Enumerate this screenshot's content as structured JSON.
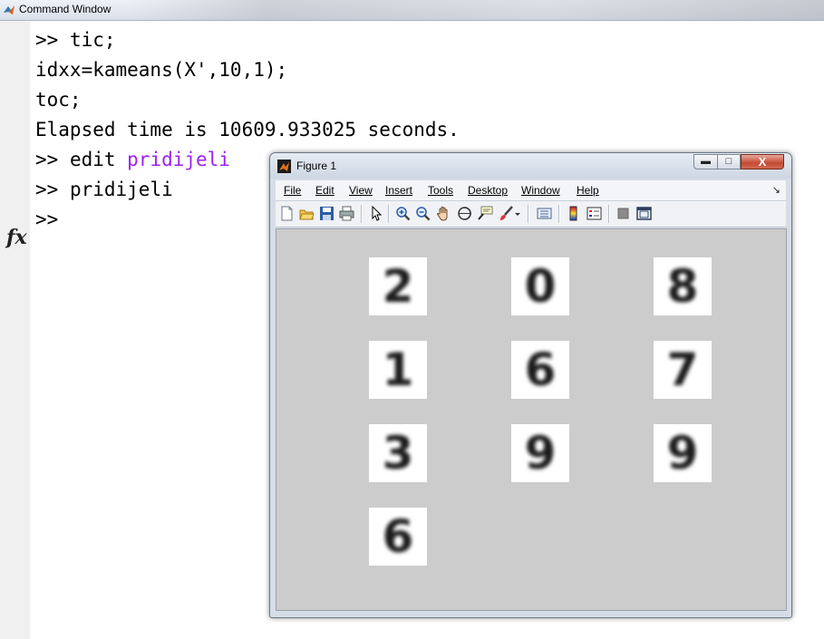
{
  "command_window": {
    "title": "Command Window",
    "lines": [
      {
        "prompt": ">> ",
        "text": "tic;"
      },
      {
        "prompt": "",
        "text": "idxx=kameans(X',10,1);"
      },
      {
        "prompt": "",
        "text": "toc;"
      },
      {
        "prompt": "",
        "text": "Elapsed time is 10609.933025 seconds."
      },
      {
        "prompt": ">> ",
        "text": "edit ",
        "arg": "pridijeli"
      },
      {
        "prompt": ">> ",
        "text": "pridijeli"
      },
      {
        "prompt": ">>",
        "text": ""
      }
    ],
    "fx_icon": "fx"
  },
  "figure": {
    "title": "Figure 1",
    "buttons": {
      "minimize": "▭",
      "maximize": "□",
      "close": "X"
    },
    "menu": [
      "File",
      "Edit",
      "View",
      "Insert",
      "Tools",
      "Desktop",
      "Window",
      "Help"
    ],
    "menu_overflow": "↘",
    "toolbar": [
      "new-figure-icon",
      "open-file-icon",
      "save-icon",
      "print-icon",
      "pointer-icon",
      "zoom-in-icon",
      "zoom-out-icon",
      "pan-icon",
      "rotate-3d-icon",
      "data-cursor-icon",
      "brush-icon",
      "link-plot-icon",
      "colorbar-icon",
      "legend-icon",
      "hide-plot-tools-icon",
      "show-plot-tools-icon"
    ],
    "digits": [
      "2",
      "0",
      "8",
      "1",
      "6",
      "7",
      "3",
      "9",
      "9",
      "6"
    ]
  },
  "colors": {
    "purple_text": "#a020f0",
    "plot_background": "#cccccc"
  }
}
